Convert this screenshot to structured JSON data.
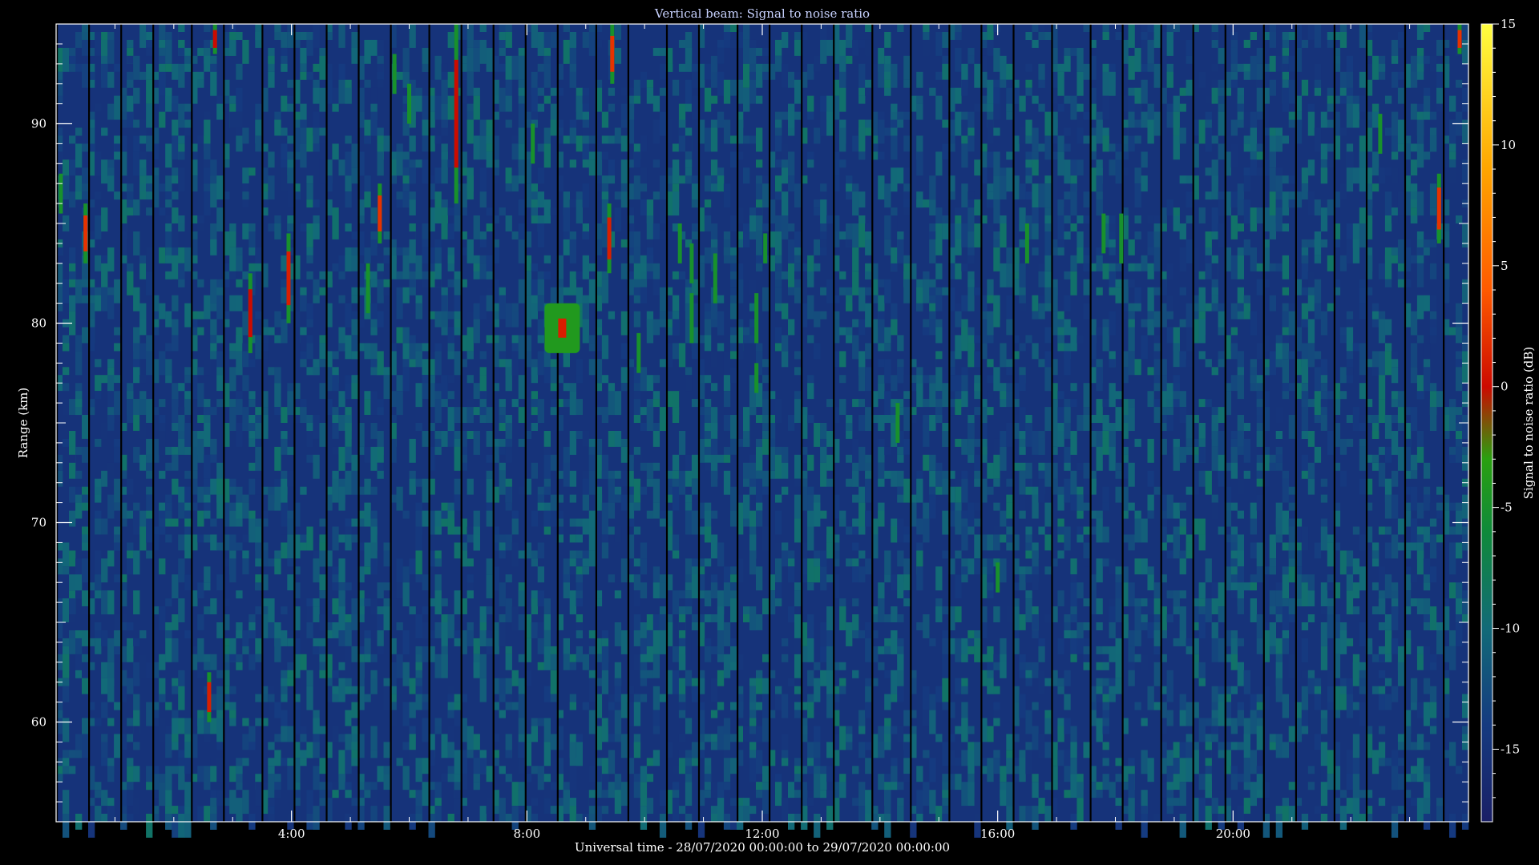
{
  "chart_data": {
    "type": "heatmap",
    "title": "Vertical beam: Signal to noise ratio",
    "xlabel": "Universal time - 28/07/2020 00:00:00 to 29/07/2020 00:00:00",
    "ylabel": "Range (km)",
    "colorbar_label": "Signal to noise ratio (dB)",
    "xlim_hours": [
      0,
      24
    ],
    "ylim_km": [
      55,
      95
    ],
    "x_ticks": [
      {
        "hour": 4,
        "label": "4:00"
      },
      {
        "hour": 8,
        "label": "8:00"
      },
      {
        "hour": 12,
        "label": "12:00"
      },
      {
        "hour": 16,
        "label": "16:00"
      },
      {
        "hour": 20,
        "label": "20:00"
      }
    ],
    "y_ticks": [
      {
        "km": 60,
        "label": "60"
      },
      {
        "km": 70,
        "label": "70"
      },
      {
        "km": 80,
        "label": "80"
      },
      {
        "km": 90,
        "label": "90"
      }
    ],
    "colorbar_range_db": [
      -18,
      15
    ],
    "colorbar_ticks": [
      {
        "db": 15,
        "label": "15"
      },
      {
        "db": 10,
        "label": "10"
      },
      {
        "db": 5,
        "label": "5"
      },
      {
        "db": 0,
        "label": "0"
      },
      {
        "db": -5,
        "label": "-5"
      },
      {
        "db": -10,
        "label": "-10"
      },
      {
        "db": -15,
        "label": "-15"
      }
    ],
    "colormap": [
      {
        "db": -18,
        "color": "#1a1f66"
      },
      {
        "db": -14,
        "color": "#153a80"
      },
      {
        "db": -10,
        "color": "#126a78"
      },
      {
        "db": -6,
        "color": "#0f8a3a"
      },
      {
        "db": -3,
        "color": "#2aa010"
      },
      {
        "db": 0,
        "color": "#cc0a00"
      },
      {
        "db": 4,
        "color": "#ff5a00"
      },
      {
        "db": 9,
        "color": "#ffa500"
      },
      {
        "db": 15,
        "color": "#ffff40"
      }
    ],
    "background_noise_db": -15,
    "echoes": [
      {
        "t": 0.08,
        "r0": 85.5,
        "r1": 87.5,
        "db": -5
      },
      {
        "t": 0.5,
        "r0": 83,
        "r1": 86,
        "db": 2
      },
      {
        "t": 2.6,
        "r0": 60,
        "r1": 62.5,
        "db": 1
      },
      {
        "t": 2.7,
        "r0": 93.5,
        "r1": 95,
        "db": 0
      },
      {
        "t": 3.3,
        "r0": 78.5,
        "r1": 82.5,
        "db": 0
      },
      {
        "t": 3.95,
        "r0": 80,
        "r1": 84.5,
        "db": 1
      },
      {
        "t": 5.3,
        "r0": 80.5,
        "r1": 83,
        "db": -5
      },
      {
        "t": 5.5,
        "r0": 84,
        "r1": 87,
        "db": 2
      },
      {
        "t": 5.75,
        "r0": 91.5,
        "r1": 93.5,
        "db": -5
      },
      {
        "t": 6.0,
        "r0": 90,
        "r1": 92,
        "db": -6
      },
      {
        "t": 6.8,
        "r0": 86,
        "r1": 95,
        "db": 0
      },
      {
        "t": 8.1,
        "r0": 88,
        "r1": 90,
        "db": -5
      },
      {
        "t": 9.4,
        "r0": 82.5,
        "r1": 86,
        "db": 1
      },
      {
        "t": 9.45,
        "r0": 92,
        "r1": 95,
        "db": 2
      },
      {
        "t": 9.9,
        "r0": 77.5,
        "r1": 79.5,
        "db": -5
      },
      {
        "t": 10.6,
        "r0": 83,
        "r1": 85,
        "db": -5
      },
      {
        "t": 10.8,
        "r0": 82,
        "r1": 84,
        "db": -5
      },
      {
        "t": 10.8,
        "r0": 79,
        "r1": 81.5,
        "db": -5
      },
      {
        "t": 11.2,
        "r0": 81,
        "r1": 83.5,
        "db": -5
      },
      {
        "t": 11.9,
        "r0": 79,
        "r1": 81.5,
        "db": -5
      },
      {
        "t": 11.9,
        "r0": 76.5,
        "r1": 78,
        "db": -5
      },
      {
        "t": 12.05,
        "r0": 83,
        "r1": 84.5,
        "db": -6
      },
      {
        "t": 14.3,
        "r0": 74,
        "r1": 76,
        "db": -4
      },
      {
        "t": 16.0,
        "r0": 66.5,
        "r1": 68,
        "db": -7
      },
      {
        "t": 16.5,
        "r0": 83,
        "r1": 85,
        "db": -5
      },
      {
        "t": 17.8,
        "r0": 83.5,
        "r1": 85.5,
        "db": -5
      },
      {
        "t": 18.1,
        "r0": 83,
        "r1": 85.5,
        "db": -5
      },
      {
        "t": 22.5,
        "r0": 88.5,
        "r1": 90.5,
        "db": -5
      },
      {
        "t": 23.5,
        "r0": 84,
        "r1": 87.5,
        "db": 2
      },
      {
        "t": 23.85,
        "r0": 93.5,
        "r1": 95,
        "db": 2
      }
    ],
    "patches": [
      {
        "t0": 8.3,
        "t1": 8.9,
        "r0": 78.5,
        "r1": 81,
        "db": -4,
        "core_db": 1
      }
    ]
  }
}
